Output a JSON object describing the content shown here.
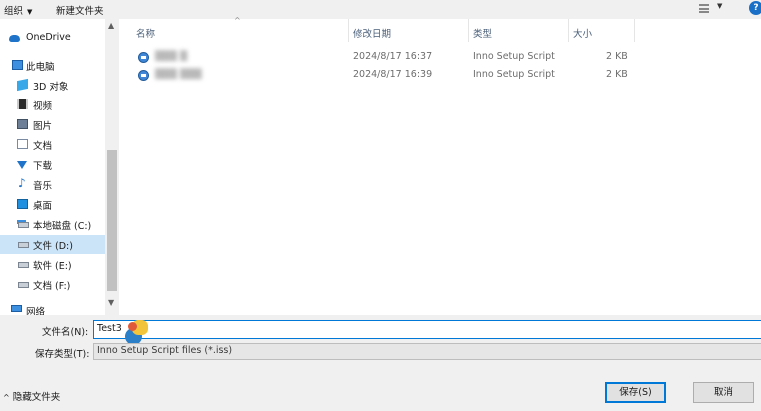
{
  "toolbar": {
    "organize_label": "组织",
    "new_folder_label": "新建文件夹",
    "help_label": "?"
  },
  "nav": {
    "items": [
      {
        "label": "OneDrive",
        "icon": "onedrive-icon"
      },
      {
        "label": "此电脑",
        "icon": "computer-icon"
      },
      {
        "label": "3D 对象",
        "icon": "3d-objects-icon"
      },
      {
        "label": "视频",
        "icon": "video-icon"
      },
      {
        "label": "图片",
        "icon": "picture-icon"
      },
      {
        "label": "文档",
        "icon": "document-icon"
      },
      {
        "label": "下载",
        "icon": "download-icon"
      },
      {
        "label": "音乐",
        "icon": "music-icon"
      },
      {
        "label": "桌面",
        "icon": "desktop-icon"
      },
      {
        "label": "本地磁盘 (C:)",
        "icon": "drive-icon"
      },
      {
        "label": "文件 (D:)",
        "icon": "drive-icon",
        "selected": true
      },
      {
        "label": "软件 (E:)",
        "icon": "drive-icon"
      },
      {
        "label": "文档 (F:)",
        "icon": "drive-icon"
      },
      {
        "label": "网络",
        "icon": "network-icon"
      }
    ]
  },
  "file_list": {
    "columns": {
      "name": "名称",
      "modified": "修改日期",
      "type": "类型",
      "size": "大小"
    },
    "rows": [
      {
        "name": "▒▒▒ ▒",
        "modified": "2024/8/17 16:37",
        "type": "Inno Setup Script",
        "size": "2 KB"
      },
      {
        "name": "▒▒▒ ▒▒▒",
        "modified": "2024/8/17 16:39",
        "type": "Inno Setup Script",
        "size": "2 KB"
      }
    ]
  },
  "form": {
    "filename_label": "文件名(N):",
    "filename_value": "Test3",
    "filetype_label": "保存类型(T):",
    "filetype_value": "Inno Setup Script files (*.iss)"
  },
  "footer": {
    "hide_folders_label": "隐藏文件夹",
    "save_label": "保存(S)",
    "cancel_label": "取消"
  },
  "colors": {
    "accent": "#0078d7",
    "selected_bg": "#cce4f7"
  }
}
